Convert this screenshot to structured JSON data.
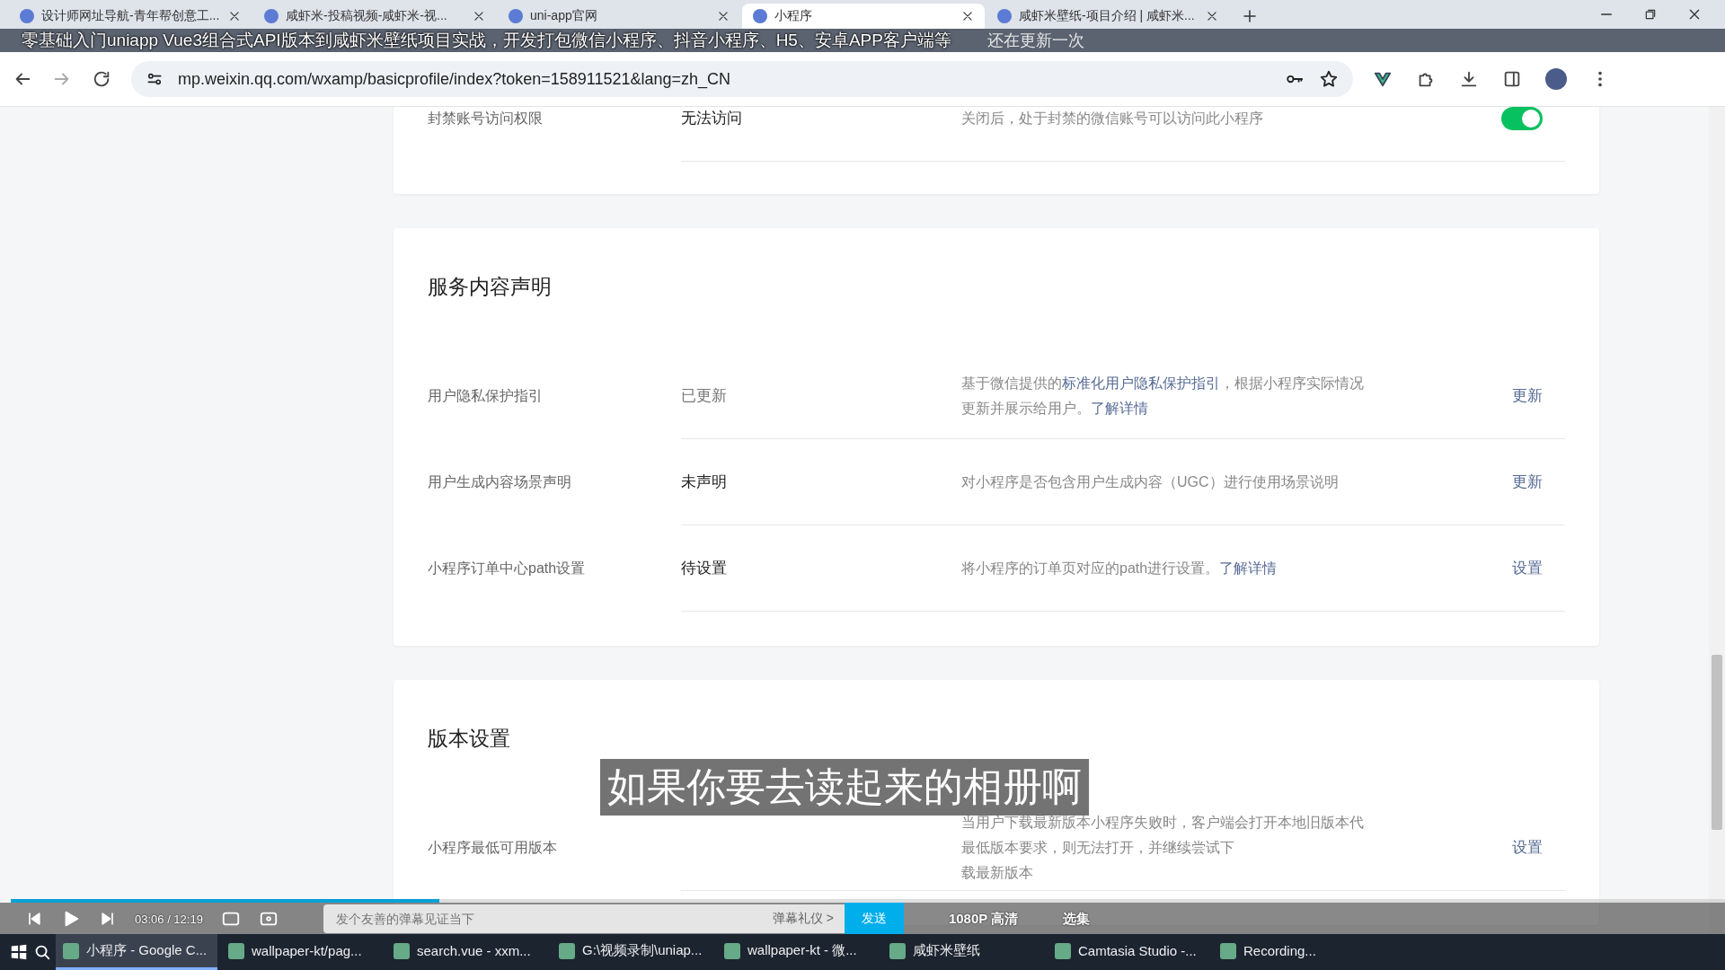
{
  "browser": {
    "tabs": [
      {
        "title": "设计师网址导航-青年帮创意工...",
        "selected": false
      },
      {
        "title": "咸虾米-投稿视频-咸虾米-视...",
        "selected": false
      },
      {
        "title": "uni-app官网",
        "selected": false
      },
      {
        "title": "小程序",
        "selected": true
      },
      {
        "title": "咸虾米壁纸-项目介绍 | 咸虾米...",
        "selected": false
      }
    ],
    "url": "mp.weixin.qq.com/wxamp/basicprofile/index?token=158911521&lang=zh_CN"
  },
  "video_title": "零基础入门uniapp Vue3组合式API版本到咸虾米壁纸项目实战，开发打包微信小程序、抖音小程序、H5、安卓APP客户端等",
  "danmaku": [
    "还在更新一次"
  ],
  "sections": [
    {
      "rows": [
        {
          "label": "封禁账号访问权限",
          "status": "无法访问",
          "muted": false,
          "description": [
            [
              {
                "text": "关闭后，处于封禁的微信账号可以访问此小程序"
              }
            ]
          ],
          "kind": "toggle",
          "on": true
        }
      ]
    },
    {
      "title": "服务内容声明",
      "rows": [
        {
          "label": "用户隐私保护指引",
          "status": "已更新",
          "muted": true,
          "description": [
            [
              {
                "text": "基于微信提供的"
              },
              {
                "text": "标准化用户隐私保护指引",
                "link": true
              },
              {
                "text": "，根据小程序实际情况"
              }
            ],
            [
              {
                "text": "更新并展示给用户。"
              },
              {
                "text": "了解详情",
                "link": true
              }
            ]
          ],
          "kind": "action",
          "action": "更新"
        },
        {
          "label": "用户生成内容场景声明",
          "status": "未声明",
          "muted": false,
          "description": [
            [
              {
                "text": "对小程序是否包含用户生成内容（UGC）进行使用场景说明"
              }
            ]
          ],
          "kind": "action",
          "action": "更新"
        },
        {
          "label": "小程序订单中心path设置",
          "status": "待设置",
          "muted": false,
          "description": [
            [
              {
                "text": "将小程序的订单页对应的path进行设置。"
              },
              {
                "text": "了解详情",
                "link": true
              }
            ]
          ],
          "kind": "action",
          "action": "设置"
        }
      ]
    },
    {
      "title": "版本设置",
      "rows": [
        {
          "label": "小程序最低可用版本",
          "description": [
            [
              {
                "text": "当用户下载最新版本小程序失败时，客户端会打开本地旧版本代"
              }
            ],
            [
              {
                "text": "最低版本要求，则无法打开，并继续尝试下"
              }
            ],
            [
              {
                "text": "载最新版本"
              }
            ]
          ],
          "kind": "action",
          "action": "设置"
        }
      ]
    }
  ],
  "subtitle": "如果你要去读起来的相册啊",
  "player": {
    "level": 0.25,
    "time": "03:06 / 12:19",
    "danmaku_placeholder": "发个友善的弹幕见证当下",
    "etiquette": "弹幕礼仪 >",
    "send": "发送",
    "quality": "1080P 高清",
    "episodes": "选集"
  },
  "taskbar": [
    {
      "title": "小程序 - Google C...",
      "selected": true
    },
    {
      "title": "wallpaper-kt/pag...",
      "selected": false
    },
    {
      "title": "search.vue - xxm...",
      "selected": false
    },
    {
      "title": "G:\\视频录制\\uniap...",
      "selected": false
    },
    {
      "title": "wallpaper-kt - 微...",
      "selected": false
    },
    {
      "title": "咸虾米壁纸",
      "selected": false
    },
    {
      "title": "Camtasia Studio -...",
      "selected": false
    },
    {
      "title": "Recording...",
      "selected": false
    }
  ]
}
